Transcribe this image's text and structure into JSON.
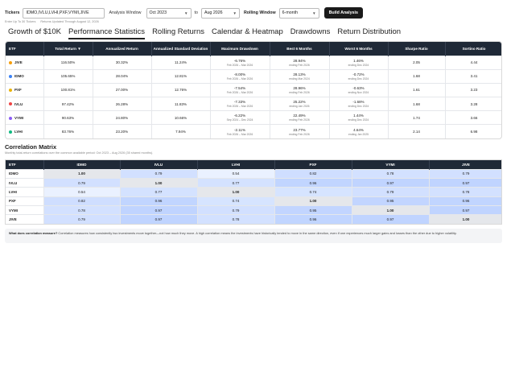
{
  "controls": {
    "tickers_label": "Tickers",
    "tickers_value": "IDMO,IVLU,LVHI,PXF,VYMI,JIVE",
    "window_label": "Analysis Window",
    "start": "Oct 2023",
    "to_label": "to",
    "end": "Aug 2026",
    "rolling_label": "Rolling Window",
    "rolling": "6-month",
    "build_label": "Build Analysis",
    "hint1": "Enter Up To 30 Tickers",
    "hint2": "Returns Updated Through August 12, 2026"
  },
  "tabs": [
    {
      "label": "Growth of $10K"
    },
    {
      "label": "Performance Statistics"
    },
    {
      "label": "Rolling Returns"
    },
    {
      "label": "Calendar & Heatmap"
    },
    {
      "label": "Drawdowns"
    },
    {
      "label": "Return Distribution"
    }
  ],
  "perf": {
    "headers": [
      "ETF",
      "Total Return ▼",
      "Annualized Return",
      "Annualized Standard Deviation",
      "Maximum Drawdown",
      "Best 6 Months",
      "Worst 6 Months",
      "Sharpe Ratio",
      "Sortino Ratio"
    ],
    "rows": [
      {
        "etf": "JIVE",
        "color": "#f59e0b",
        "total": "116.50%",
        "ann": "30.32%",
        "std": "11.24%",
        "dd": "-6.76%",
        "dd_sub": "Feb 2026 – Mar 2026",
        "best": "28.94%",
        "best_sub": "ending Feb 2026",
        "worst": "1.46%",
        "worst_sub": "ending Dec 2024",
        "sharpe": "2.05",
        "sortino": "4.44"
      },
      {
        "etf": "IDMO",
        "color": "#3b82f6",
        "total": "105.65%",
        "ann": "28.04%",
        "std": "12.81%",
        "dd": "-8.00%",
        "dd_sub": "Feb 2026 – Mar 2026",
        "best": "28.13%",
        "best_sub": "ending Mar 2024",
        "worst": "-0.72%",
        "worst_sub": "ending Dec 2024",
        "sharpe": "1.68",
        "sortino": "3.41"
      },
      {
        "etf": "PXF",
        "color": "#eab308",
        "total": "100.81%",
        "ann": "27.00%",
        "std": "12.76%",
        "dd": "-7.54%",
        "dd_sub": "Feb 2026 – Mar 2026",
        "best": "28.96%",
        "best_sub": "ending Feb 2026",
        "worst": "-0.63%",
        "worst_sub": "ending Nov 2024",
        "sharpe": "1.61",
        "sortino": "3.23"
      },
      {
        "etf": "IVLU",
        "color": "#ef4444",
        "total": "97.42%",
        "ann": "26.28%",
        "std": "11.83%",
        "dd": "-7.33%",
        "dd_sub": "Feb 2026 – Mar 2026",
        "best": "25.22%",
        "best_sub": "ending Jan 2026",
        "worst": "-1.68%",
        "worst_sub": "ending Dec 2024",
        "sharpe": "1.68",
        "sortino": "3.28"
      },
      {
        "etf": "VYMI",
        "color": "#8b5cf6",
        "total": "90.63%",
        "ann": "24.80%",
        "std": "10.66%",
        "dd": "-6.22%",
        "dd_sub": "Sep 2024 – Dec 2024",
        "best": "22.49%",
        "best_sub": "ending Feb 2026",
        "worst": "1.44%",
        "worst_sub": "ending Dec 2024",
        "sharpe": "1.74",
        "sortino": "3.66"
      },
      {
        "etf": "LVHI",
        "color": "#10b981",
        "total": "83.76%",
        "ann": "23.20%",
        "std": "7.94%",
        "dd": "-2.11%",
        "dd_sub": "Feb 2026 – Mar 2026",
        "best": "23.77%",
        "best_sub": "ending Feb 2026",
        "worst": "4.64%",
        "worst_sub": "ending Jan 2025",
        "sharpe": "2.14",
        "sortino": "6.98"
      }
    ]
  },
  "corr": {
    "title": "Correlation Matrix",
    "subtitle": "Monthly total-return correlations over the common available period: Oct 2023 – Aug 2026 (35 shared months).",
    "headers": [
      "ETF",
      "IDMO",
      "IVLU",
      "LVHI",
      "PXF",
      "VYMI",
      "JIVE"
    ],
    "rows": [
      {
        "etf": "IDMO",
        "cells": [
          "1.00",
          "0.79",
          "0.54",
          "0.82",
          "0.78",
          "0.79"
        ]
      },
      {
        "etf": "IVLU",
        "cells": [
          "0.79",
          "1.00",
          "0.77",
          "0.96",
          "0.97",
          "0.97"
        ]
      },
      {
        "etf": "LVHI",
        "cells": [
          "0.54",
          "0.77",
          "1.00",
          "0.74",
          "0.79",
          "0.78"
        ]
      },
      {
        "etf": "PXF",
        "cells": [
          "0.82",
          "0.96",
          "0.74",
          "1.00",
          "0.95",
          "0.96"
        ]
      },
      {
        "etf": "VYMI",
        "cells": [
          "0.78",
          "0.97",
          "0.79",
          "0.95",
          "1.00",
          "0.97"
        ]
      },
      {
        "etf": "JIVE",
        "cells": [
          "0.79",
          "0.97",
          "0.78",
          "0.96",
          "0.97",
          "1.00"
        ]
      }
    ]
  },
  "explain": {
    "bold": "What does correlation measure?",
    "text": " Correlation measures how consistently two investments move together—not how much they move. A high correlation means the investments have historically tended to move in the same direction, even if one experiences much larger gains and losses than the other due to higher volatility."
  }
}
